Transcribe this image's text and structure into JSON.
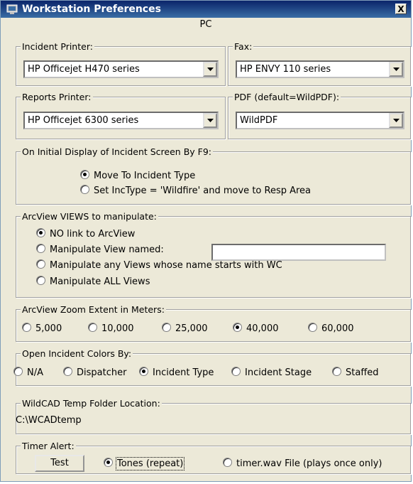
{
  "window": {
    "title": "Workstation Preferences",
    "close_label": "X",
    "subtitle": "PC"
  },
  "printers": {
    "incident": {
      "legend": "Incident Printer:",
      "value": "HP Officejet H470 series"
    },
    "fax": {
      "legend": "Fax:",
      "value": "HP ENVY 110 series"
    },
    "reports": {
      "legend": "Reports Printer:",
      "value": "HP Officejet 6300 series"
    },
    "pdf": {
      "legend": "PDF (default=WildPDF):",
      "value": "WildPDF"
    }
  },
  "initial_display": {
    "legend": "On Initial Display of Incident Screen By F9:",
    "options": [
      {
        "label": "Move To Incident Type",
        "selected": true
      },
      {
        "label": "Set IncType = 'Wildfire' and move to Resp Area",
        "selected": false
      }
    ]
  },
  "arcview_views": {
    "legend": "ArcView VIEWS to manipulate:",
    "options": [
      {
        "label": "NO link to ArcView",
        "selected": true
      },
      {
        "label": "Manipulate View named:",
        "selected": false
      },
      {
        "label": "Manipulate any Views whose name starts with WC",
        "selected": false
      },
      {
        "label": "Manipulate ALL Views",
        "selected": false
      }
    ],
    "view_name_value": ""
  },
  "zoom": {
    "legend": "ArcView Zoom Extent in Meters:",
    "options": [
      {
        "label": "5,000",
        "selected": false
      },
      {
        "label": "10,000",
        "selected": false
      },
      {
        "label": "25,000",
        "selected": false
      },
      {
        "label": "40,000",
        "selected": true
      },
      {
        "label": "60,000",
        "selected": false
      }
    ]
  },
  "colors": {
    "legend": "Open Incident Colors By:",
    "options": [
      {
        "label": "N/A",
        "selected": false
      },
      {
        "label": "Dispatcher",
        "selected": false
      },
      {
        "label": "Incident Type",
        "selected": true
      },
      {
        "label": "Incident Stage",
        "selected": false
      },
      {
        "label": "Staffed",
        "selected": false
      }
    ]
  },
  "temp_folder": {
    "legend": "WildCAD Temp Folder Location:",
    "value": "C:\\WCADtemp"
  },
  "timer": {
    "legend": "Timer Alert:",
    "test_label": "Test",
    "options": [
      {
        "label": "Tones (repeat)",
        "selected": true
      },
      {
        "label": "timer.wav File (plays once only)",
        "selected": false
      }
    ]
  },
  "palette": {
    "title_bar": "#0a246a",
    "dialog_bg": "#ECE9D8"
  }
}
